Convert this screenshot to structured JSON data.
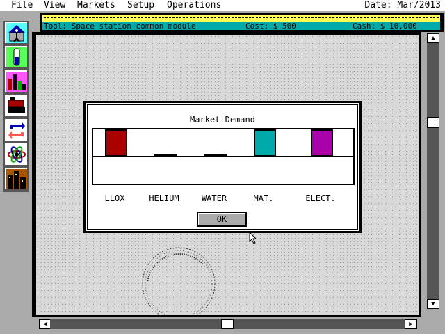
{
  "menu": {
    "file": "File",
    "view": "View",
    "markets": "Markets",
    "setup": "Setup",
    "operations": "Operations",
    "date": "Date: Mar/2013"
  },
  "toolbar": {
    "tool": "Tool: Space station common module",
    "cost": "Cost: $ 500",
    "cash": "Cash: $ 10,000"
  },
  "palette": [
    {
      "icon": "building-tool-icon"
    },
    {
      "icon": "test-tube-icon"
    },
    {
      "icon": "graph-icon"
    },
    {
      "icon": "machine-icon"
    },
    {
      "icon": "transfer-arrows-icon"
    },
    {
      "icon": "atom-icon"
    },
    {
      "icon": "city-icon"
    }
  ],
  "dialog": {
    "title": "Market Demand",
    "ok_label": "OK"
  },
  "chart_data": {
    "type": "bar",
    "title": "Market Demand",
    "categories": [
      "LLOX",
      "HELIUM",
      "WATER",
      "MAT.",
      "ELECT."
    ],
    "values": [
      1,
      0,
      0,
      1,
      1
    ],
    "colors": [
      "#aa0000",
      "#000000",
      "#000000",
      "#00aaaa",
      "#aa00aa"
    ],
    "ylim": [
      0,
      1
    ]
  },
  "colors": {
    "status_yellow": "#ffff55",
    "status_cyan": "#00aaaa",
    "llox": "#aa0000",
    "mat": "#00aaaa",
    "elect": "#aa00aa"
  }
}
